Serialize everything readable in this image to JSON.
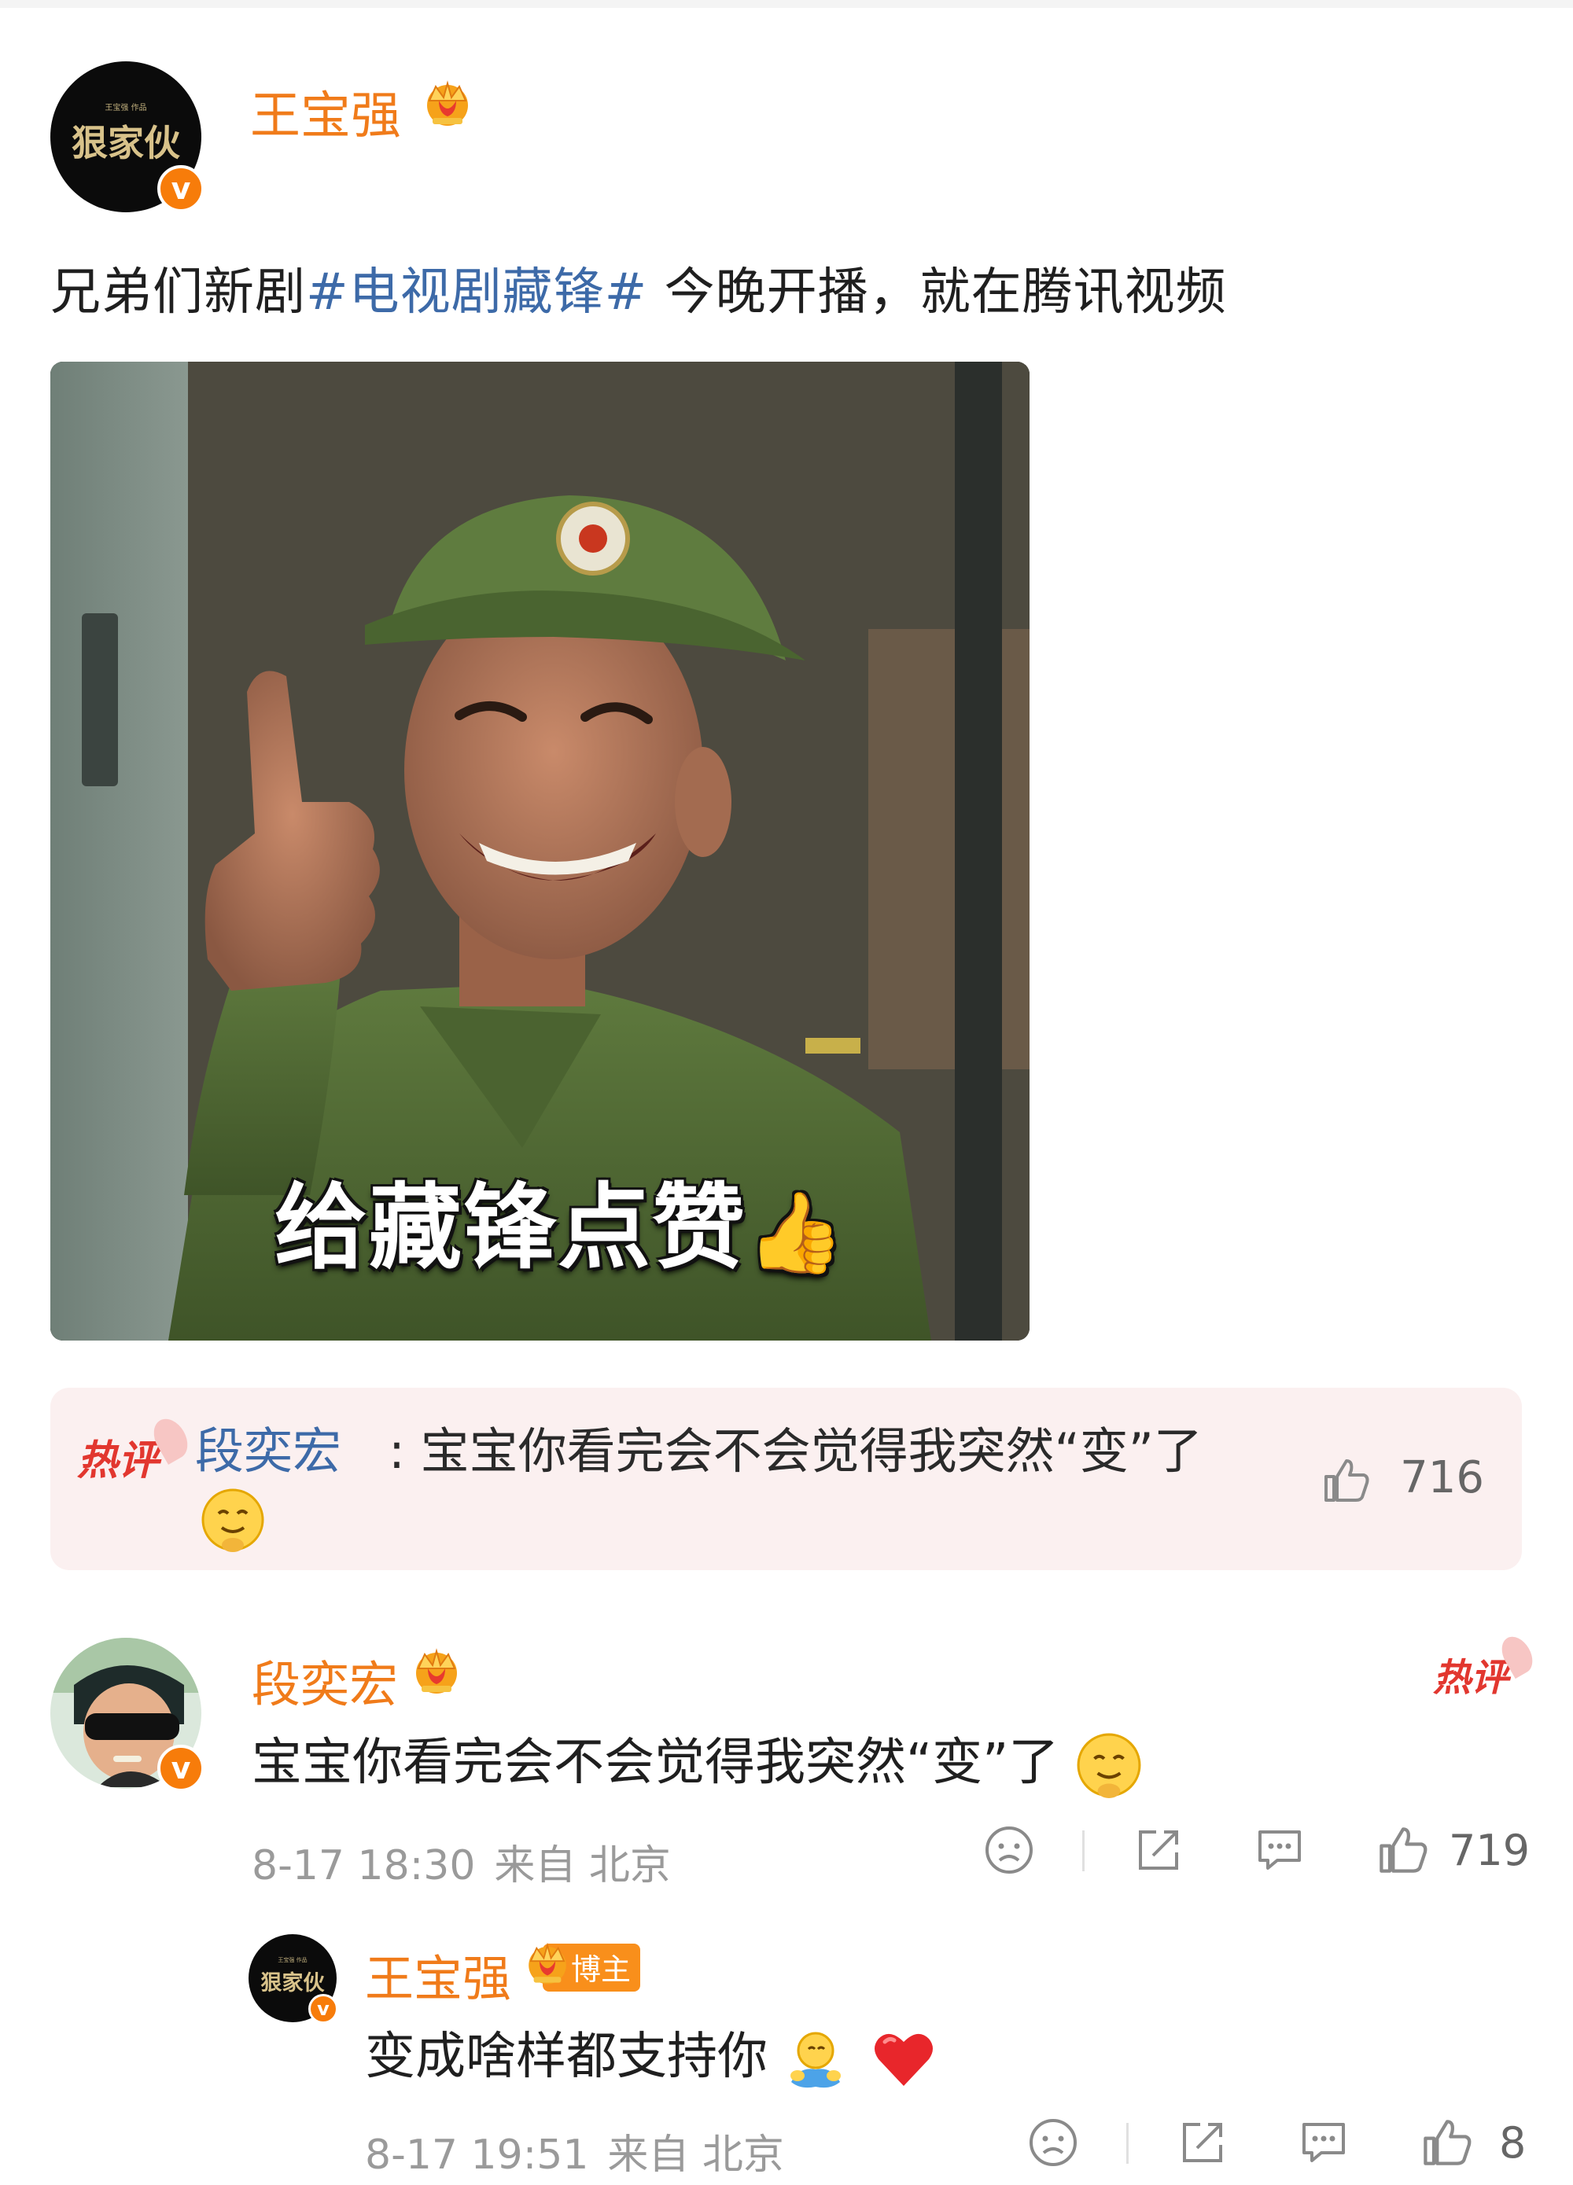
{
  "post": {
    "author": "王宝强",
    "avatar_logo": "狠家伙",
    "text_before": "兄弟们新剧",
    "hashtag": "#电视剧藏锋#",
    "text_after": " 今晚开播，就在腾讯视频",
    "image_caption": "给藏锋点赞"
  },
  "hot_comment": {
    "tag": "热评",
    "author": "段奕宏",
    "text": ": 宝宝你看完会不会觉得我突然“变”了",
    "likes": "716"
  },
  "comments": [
    {
      "author": "段奕宏",
      "tag": "热评",
      "text": "宝宝你看完会不会觉得我突然“变”了",
      "time": "8-17 18:30",
      "source": "来自 北京",
      "likes": "719"
    }
  ],
  "reply": {
    "author": "王宝强",
    "badge": "博主",
    "avatar_logo": "狠家伙",
    "text": "变成啥样都支持你",
    "time": "8-17 19:51",
    "source": "来自 北京",
    "likes": "8"
  },
  "icons": [
    "verified-v-icon",
    "crown-icon",
    "grin-emoji-icon",
    "sad-face-icon",
    "share-icon",
    "comment-icon",
    "like-icon",
    "hug-emoji-icon",
    "heart-icon"
  ],
  "colors": {
    "username": "#f07b1a",
    "hashtag": "#3d6aa8",
    "hot_tag": "#e2372f",
    "hot_bg": "#fbf0f0",
    "verified": "#f77c0a"
  }
}
